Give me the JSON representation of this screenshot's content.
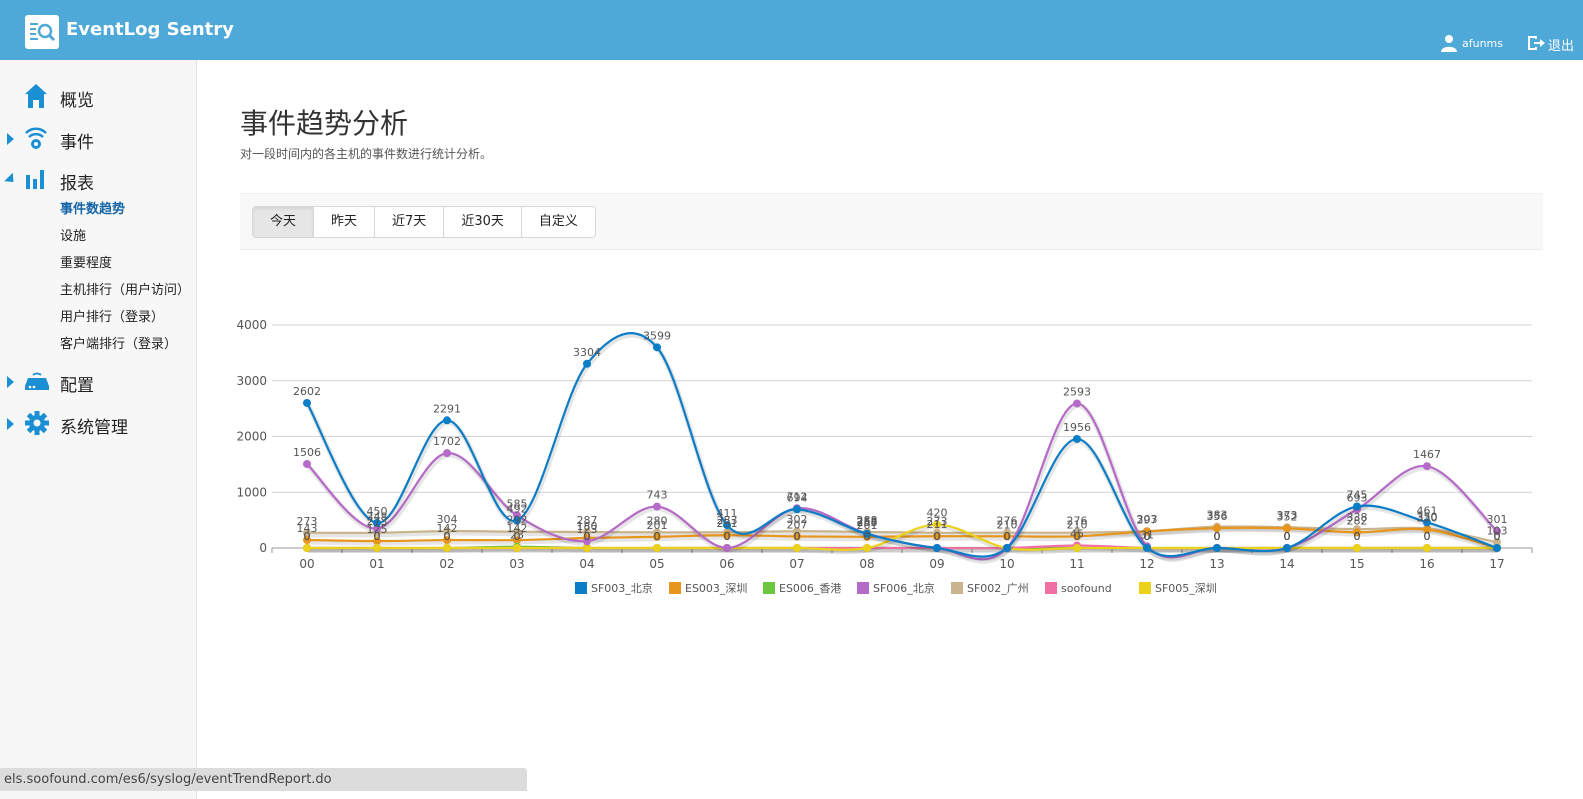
{
  "header": {
    "app_title": "EventLog Sentry",
    "username": "afunms",
    "logout_label": "退出"
  },
  "sidebar": {
    "items": [
      {
        "label": "概览",
        "icon": "home-icon"
      },
      {
        "label": "事件",
        "icon": "signal-icon"
      },
      {
        "label": "报表",
        "icon": "bar-chart-icon"
      },
      {
        "label": "配置",
        "icon": "router-icon"
      },
      {
        "label": "系统管理",
        "icon": "gear-icon"
      }
    ],
    "report_subitems": [
      "事件数趋势",
      "设施",
      "重要程度",
      "主机排行（用户访问）",
      "用户排行（登录）",
      "客户端排行（登录）"
    ]
  },
  "page": {
    "title": "事件趋势分析",
    "description": "对一段时间内的各主机的事件数进行统计分析。"
  },
  "filters": {
    "buttons": [
      "今天",
      "昨天",
      "近7天",
      "近30天",
      "自定义"
    ],
    "active": "今天"
  },
  "status_url": "els.soofound.com/es6/syslog/eventTrendReport.do",
  "chart_data": {
    "type": "line",
    "smooth": true,
    "categories": [
      "00",
      "01",
      "02",
      "03",
      "04",
      "05",
      "06",
      "07",
      "08",
      "09",
      "10",
      "11",
      "12",
      "13",
      "14",
      "15",
      "16",
      "17"
    ],
    "ylim": [
      0,
      4000
    ],
    "yticks": [
      0,
      1000,
      2000,
      3000,
      4000
    ],
    "grid": true,
    "legend_position": "bottom",
    "series": [
      {
        "name": "SF003_北京",
        "color": "#0a7dc6",
        "values": [
          2602,
          450,
          2291,
          492,
          3304,
          3599,
          411,
          694,
          253,
          0,
          0,
          1956,
          0,
          0,
          0,
          745,
          461,
          0
        ]
      },
      {
        "name": "ES003_深圳",
        "color": "#e8951c",
        "values": [
          143,
          125,
          142,
          142,
          180,
          201,
          231,
          207,
          201,
          211,
          210,
          210,
          297,
          356,
          352,
          282,
          330,
          0
        ]
      },
      {
        "name": "ES006_香港",
        "color": "#6cc73f",
        "values": [
          0,
          0,
          0,
          23,
          0,
          0,
          0,
          0,
          0,
          0,
          0,
          0,
          0,
          0,
          0,
          0,
          0,
          0
        ]
      },
      {
        "name": "SF006_北京",
        "color": "#b56ac7",
        "values": [
          1506,
          348,
          1702,
          585,
          123,
          743,
          0,
          712,
          258,
          0,
          0,
          2593,
          31,
          0,
          0,
          693,
          1467,
          301
        ]
      },
      {
        "name": "SF002_广州",
        "color": "#c9b48e",
        "values": [
          273,
          273,
          304,
          292,
          287,
          280,
          283,
          302,
          288,
          273,
          276,
          276,
          303,
          383,
          373,
          338,
          350,
          103
        ]
      },
      {
        "name": "soofound",
        "color": "#f070a6",
        "values": [
          0,
          0,
          0,
          0,
          0,
          0,
          0,
          0,
          0,
          0,
          0,
          45,
          0,
          0,
          0,
          0,
          0,
          0
        ]
      },
      {
        "name": "SF005_深圳",
        "color": "#ecd21a",
        "values": [
          0,
          0,
          0,
          0,
          0,
          0,
          0,
          0,
          0,
          420,
          0,
          0,
          0,
          0,
          0,
          0,
          0,
          0
        ]
      }
    ]
  }
}
